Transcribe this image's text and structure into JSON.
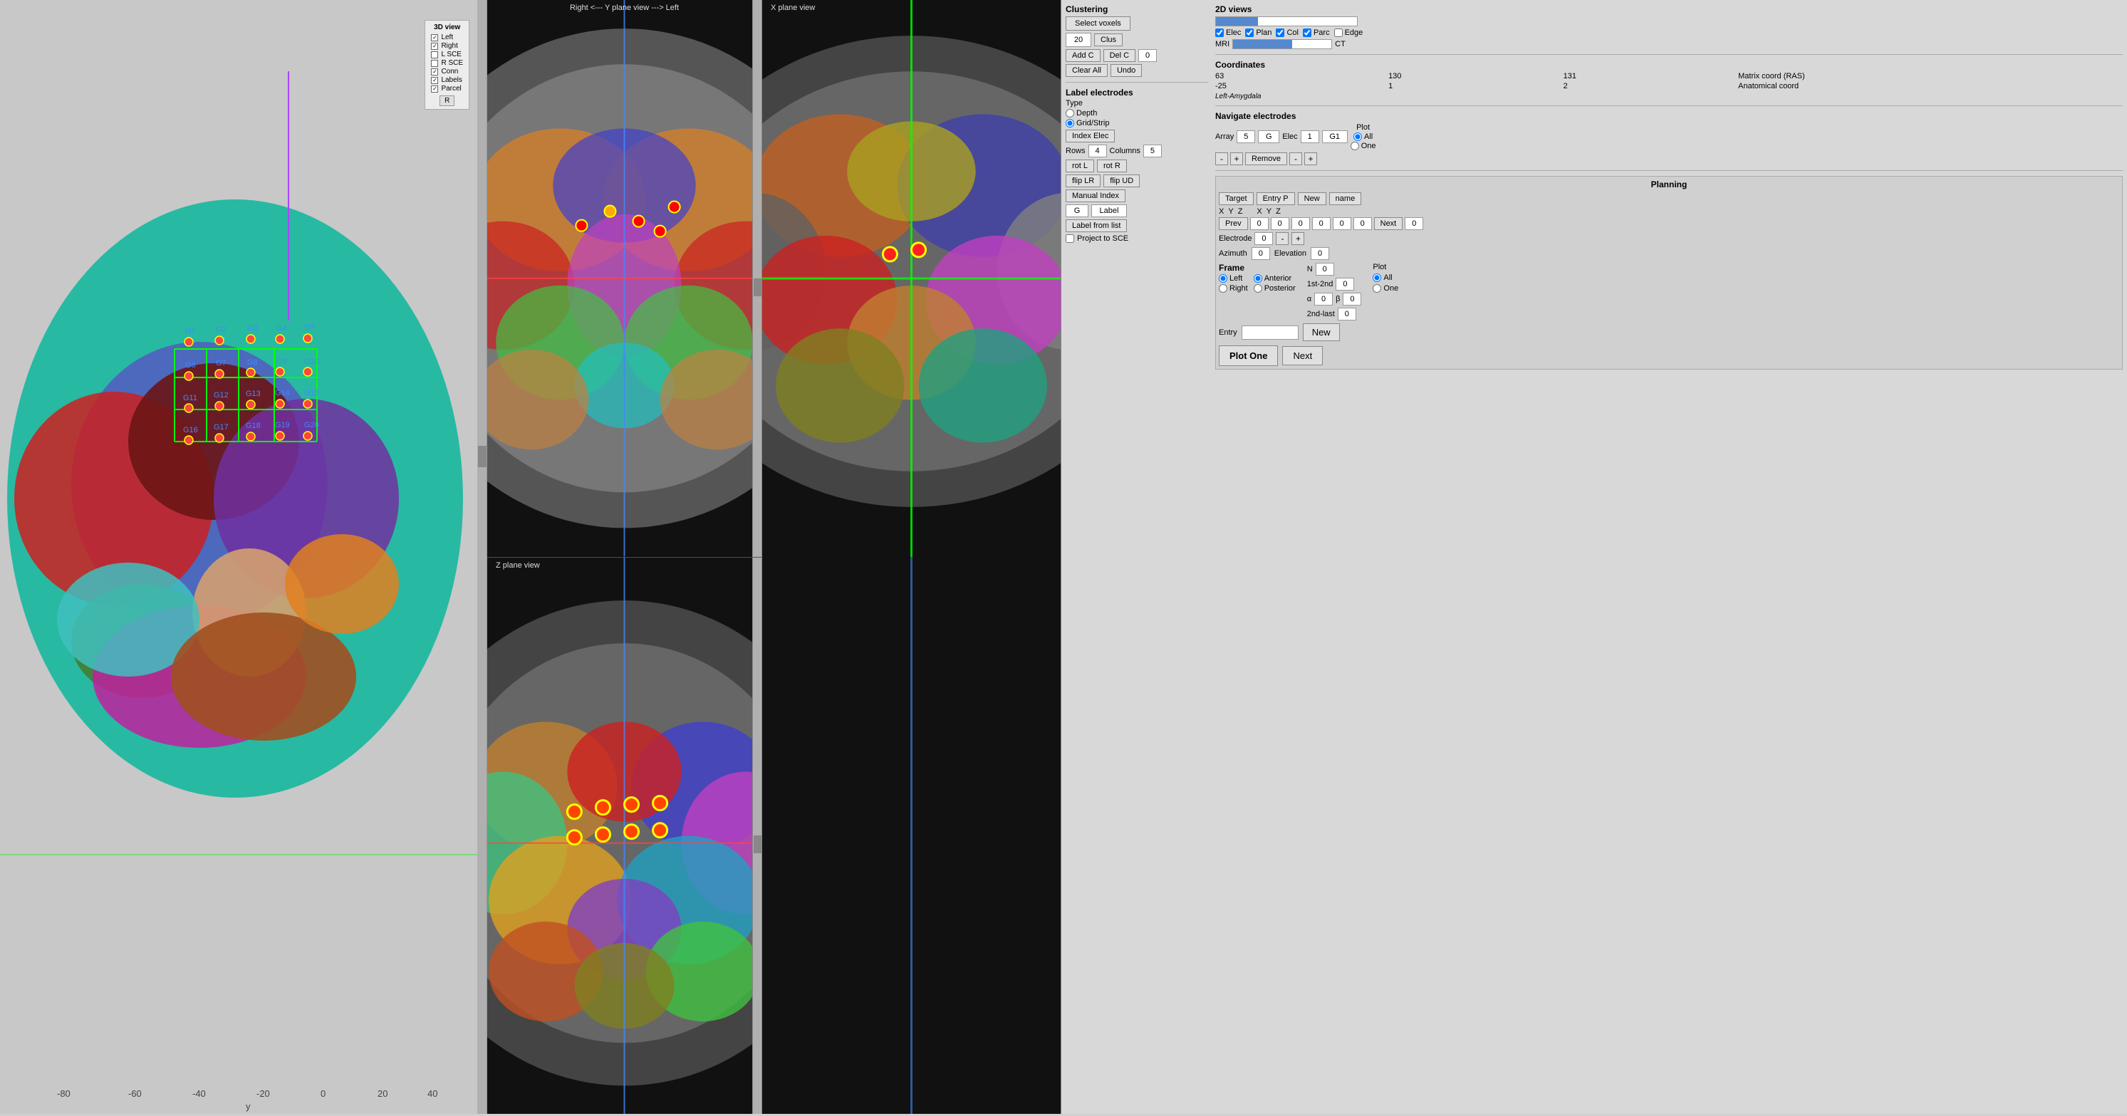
{
  "window": {
    "title_3d": "3D view",
    "title_y": "Y plane view",
    "title_x": "X plane view",
    "title_z": "Z plane view",
    "y_header": "Right <---   Y plane view   ---> Left",
    "x_header": "X plane view"
  },
  "legend_3d": {
    "title": "3D view",
    "items": [
      {
        "label": "Left",
        "checked": true
      },
      {
        "label": "Right",
        "checked": true
      },
      {
        "label": "L SCE",
        "checked": false
      },
      {
        "label": "R SCE",
        "checked": false
      },
      {
        "label": "Conn",
        "checked": true
      },
      {
        "label": "Labels",
        "checked": true
      },
      {
        "label": "Parcel",
        "checked": true
      }
    ],
    "r_button": "R"
  },
  "clustering": {
    "title": "Clustering",
    "select_voxels_btn": "Select voxels",
    "clus_value": "20",
    "clus_btn": "Clus",
    "add_c_btn": "Add C",
    "del_c_btn": "Del C",
    "del_c_value": "0",
    "clear_all_btn": "Clear All",
    "undo_btn": "Undo"
  },
  "label_electrodes": {
    "title": "Label electrodes",
    "type_label": "Type",
    "depth_label": "Depth",
    "grid_strip_label": "Grid/Strip",
    "index_elec_btn": "Index Elec",
    "rows_label": "Rows",
    "cols_label": "Columns",
    "rows_value": "4",
    "cols_value": "5",
    "rot_l_btn": "rot L",
    "rot_r_btn": "rot R",
    "flip_lr_btn": "flip LR",
    "flip_ud_btn": "flip UD",
    "manual_index_btn": "Manual Index",
    "g_value": "G",
    "label_value": "Label",
    "label_from_list_btn": "Label from list",
    "project_to_sce_label": "Project to SCE"
  },
  "views_2d": {
    "title": "2D views",
    "slider_percent": 30,
    "elec_checked": true,
    "plan_checked": true,
    "col_checked": true,
    "parc_checked": true,
    "edge_checked": false,
    "mri_label": "MRI",
    "ct_label": "CT",
    "mri_slider_percent": 60
  },
  "coordinates": {
    "title": "Coordinates",
    "x": "63",
    "y": "130",
    "z": "131",
    "matrix_label": "Matrix coord (RAS)",
    "neg25": "-25",
    "one": "1",
    "two": "2",
    "anatomical_label": "Anatomical coord",
    "region_label": "Left-Amygdala"
  },
  "navigate": {
    "title": "Navigate electrodes",
    "array_label": "Array",
    "array_value": "5",
    "g_label": "G",
    "elec_label": "Elec",
    "elec_value": "1",
    "g1_label": "G1",
    "remove_btn": "Remove",
    "plot_label": "Plot",
    "all_radio": "All",
    "one_radio": "One"
  },
  "planning": {
    "title": "Planning",
    "target_btn": "Target",
    "entry_p_btn": "Entry P",
    "new_btn": "New",
    "name_btn": "name",
    "x_label": "X",
    "y_label": "Y",
    "z_label": "Z",
    "prev_btn": "Prev",
    "next_btn": "Next",
    "next_value": "0",
    "x0": "0",
    "y0": "0",
    "z0": "0",
    "x1": "0",
    "y1": "0",
    "z1": "0",
    "electrode_label": "Electrode",
    "electrode_value": "0",
    "azimuth_label": "Azimuth",
    "azimuth_value": "0",
    "elevation_label": "Elevation",
    "elevation_value": "0",
    "frame_title": "Frame",
    "left_radio": "Left",
    "right_radio": "Right",
    "anterior_radio": "Anterior",
    "posterior_radio": "Posterior",
    "n_label": "N",
    "n_value": "0",
    "first_second_label": "1st-2nd",
    "first_second_value": "0",
    "alpha_label": "α",
    "alpha_value": "0",
    "beta_label": "β",
    "beta_value": "0",
    "second_last_label": "2nd-last",
    "second_last_value": "0",
    "plot_btn": "Plot",
    "plot_all_radio": "All",
    "plot_one_radio": "One",
    "entry_label": "Entry",
    "entry_value": "",
    "plot_one_big_btn": "Plot One"
  },
  "axis": {
    "x_neg80": "-80",
    "x_neg60": "-60",
    "x_neg40": "-40",
    "x_neg20": "-20",
    "x_0": "0",
    "x_20": "20",
    "x_40": "40",
    "y_label": "y"
  }
}
